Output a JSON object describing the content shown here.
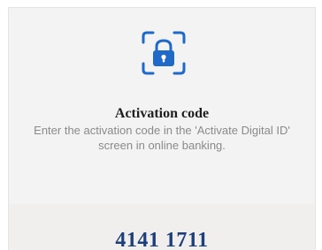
{
  "icon": "face-id-lock-icon",
  "colors": {
    "accent": "#1f69c8",
    "code_text": "#1d3f7c",
    "title_text": "#1e1e1e",
    "desc_text": "#8a8a8a"
  },
  "activation": {
    "title": "Activation code",
    "description": "Enter the activation code in the 'Activate Digital ID' screen in online banking.",
    "code": "4141 1711"
  }
}
